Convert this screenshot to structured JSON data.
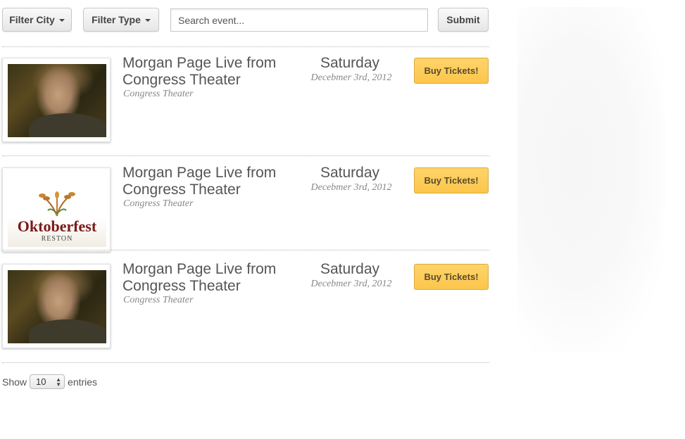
{
  "filters": {
    "city_label": "Filter City",
    "type_label": "Filter Type",
    "search_placeholder": "Search event...",
    "submit_label": "Submit"
  },
  "events": [
    {
      "title": "Morgan Page Live from Congress Theater",
      "venue": "Congress Theater",
      "day": "Saturday",
      "date": "Decebmer 3rd, 2012",
      "button": "Buy Tickets!",
      "image": "artist-photo"
    },
    {
      "title": "Morgan Page Live from Congress Theater",
      "venue": "Congress Theater",
      "day": "Saturday",
      "date": "Decebmer 3rd, 2012",
      "button": "Buy Tickets!",
      "image": "oktoberfest-logo",
      "logo_text": "Oktoberfest",
      "logo_sub": "RESTON"
    },
    {
      "title": "Morgan Page Live from Congress Theater",
      "venue": "Congress Theater",
      "day": "Saturday",
      "date": "Decebmer 3rd, 2012",
      "button": "Buy Tickets!",
      "image": "artist-photo"
    }
  ],
  "pagination": {
    "show_label": "Show",
    "entries_value": "10",
    "entries_label": "entries"
  },
  "colors": {
    "buy_button": "#fbc64c",
    "buy_border": "#d9a93c",
    "text": "#555555",
    "muted": "#888888"
  }
}
